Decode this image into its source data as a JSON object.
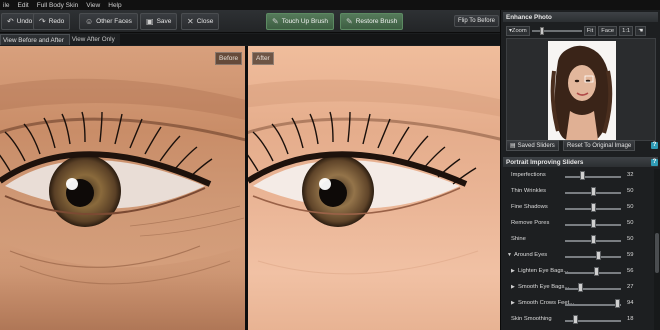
{
  "menu": [
    "ile",
    "Edit",
    "Full Body Skin",
    "View",
    "Help"
  ],
  "toolbar": {
    "undo": "Undo",
    "redo": "Redo",
    "other_faces": "Other Faces",
    "save": "Save",
    "close": "Close",
    "touch_up_brush": "Touch Up Brush",
    "restore_brush": "Restore Brush",
    "flip_to_before": "Flip To Before"
  },
  "view_tabs": [
    "View Before and After",
    "View After Only"
  ],
  "canvas": {
    "before_label": "Before",
    "after_label": "After"
  },
  "enhance_panel": {
    "title": "Enhance Photo",
    "zoom_label": "Zoom",
    "zoom_level": 0.2,
    "fit": "Fit",
    "face": "Face",
    "one_to_one": "1:1",
    "saved_sliders": "Saved Sliders",
    "reset": "Reset To Original Image"
  },
  "sliders_panel": {
    "title": "Portrait Improving Sliders",
    "help": "?",
    "items": [
      {
        "label": "Imperfections",
        "value": "32",
        "fraction": 0.32
      },
      {
        "label": "Thin Wrinkles",
        "value": "50",
        "fraction": 0.5
      },
      {
        "label": "Fine Shadows",
        "value": "50",
        "fraction": 0.5
      },
      {
        "label": "Remove Pores",
        "value": "50",
        "fraction": 0.5
      },
      {
        "label": "Shine",
        "value": "50",
        "fraction": 0.5
      },
      {
        "label": "Around Eyes",
        "value": "59",
        "fraction": 0.59
      },
      {
        "label": "Lighten Eye Bags...",
        "value": "56",
        "fraction": 0.56
      },
      {
        "label": "Smooth Eye Bags...",
        "value": "27",
        "fraction": 0.27
      },
      {
        "label": "Smooth Crows Feet...",
        "value": "94",
        "fraction": 0.94
      },
      {
        "label": "Skin Smoothing",
        "value": "18",
        "fraction": 0.18
      }
    ]
  },
  "colors": {
    "accent_green": "#557a5a",
    "help_blue": "#2f9bb5"
  }
}
